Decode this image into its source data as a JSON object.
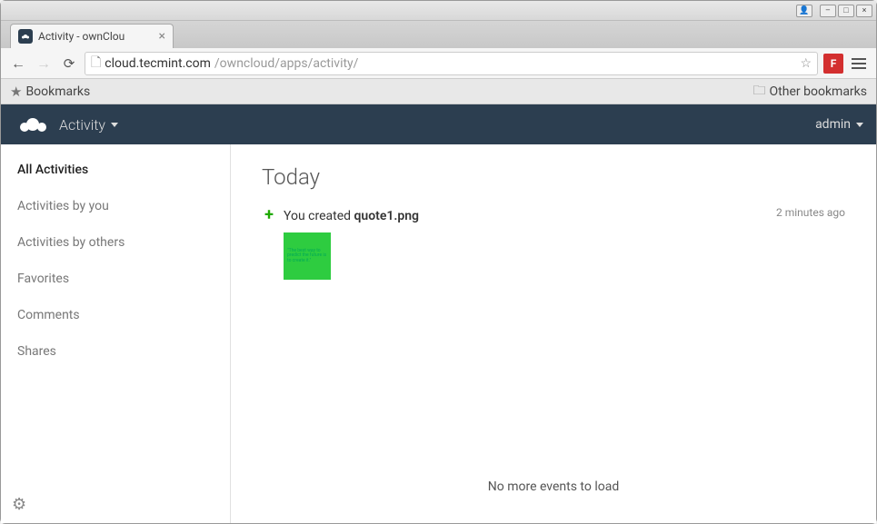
{
  "os": {
    "user_icon": "👤",
    "minimize": "–",
    "maximize": "□",
    "close": "×"
  },
  "browser": {
    "tab_title": "Activity - ownClou",
    "url_domain": "cloud.tecmint.com",
    "url_path": "/owncloud/apps/activity/",
    "extension_label": "F"
  },
  "bookmarks": {
    "label": "Bookmarks",
    "other_label": "Other bookmarks"
  },
  "app": {
    "title": "Activity",
    "user": "admin"
  },
  "sidebar": {
    "items": [
      {
        "label": "All Activities",
        "active": true
      },
      {
        "label": "Activities by you",
        "active": false
      },
      {
        "label": "Activities by others",
        "active": false
      },
      {
        "label": "Favorites",
        "active": false
      },
      {
        "label": "Comments",
        "active": false
      },
      {
        "label": "Shares",
        "active": false
      }
    ]
  },
  "content": {
    "day_heading": "Today",
    "activity": {
      "prefix": "You created ",
      "filename": "quote1.png",
      "time": "2 minutes ago"
    },
    "no_more_text": "No more events to load"
  }
}
